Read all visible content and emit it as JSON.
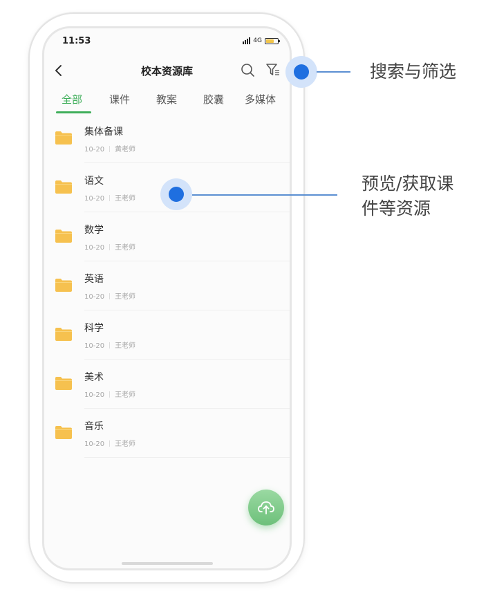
{
  "status_bar": {
    "time": "11:53",
    "network": "4G",
    "battery_level": 0.7
  },
  "nav": {
    "title": "校本资源库"
  },
  "tabs": [
    {
      "label": "全部",
      "active": true
    },
    {
      "label": "课件",
      "active": false
    },
    {
      "label": "教案",
      "active": false
    },
    {
      "label": "胶囊",
      "active": false
    },
    {
      "label": "多媒体",
      "active": false
    }
  ],
  "items": [
    {
      "title": "集体备课",
      "date": "10-20",
      "author": "黄老师"
    },
    {
      "title": "语文",
      "date": "10-20",
      "author": "王老师"
    },
    {
      "title": "数学",
      "date": "10-20",
      "author": "王老师"
    },
    {
      "title": "英语",
      "date": "10-20",
      "author": "王老师"
    },
    {
      "title": "科学",
      "date": "10-20",
      "author": "王老师"
    },
    {
      "title": "美术",
      "date": "10-20",
      "author": "王老师"
    },
    {
      "title": "音乐",
      "date": "10-20",
      "author": "王老师"
    }
  ],
  "callouts": {
    "search_filter": "搜索与筛选",
    "preview_line1": "预览/获取课",
    "preview_line2": "件等资源"
  },
  "colors": {
    "accent_green": "#3fae5a",
    "callout_blue": "#1f6fe0",
    "folder_yellow": "#f6c14f"
  },
  "icons": [
    "back-icon",
    "search-icon",
    "filter-icon",
    "folder-icon",
    "upload-cloud-icon"
  ]
}
